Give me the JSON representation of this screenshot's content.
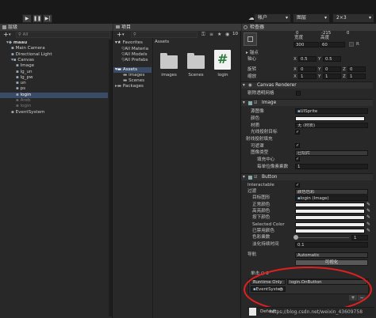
{
  "toolbar": {
    "account_label": "帐户",
    "layers_label": "图层",
    "layout_label": "2×3"
  },
  "hierarchy": {
    "tab": "层级",
    "search_placeholder": "All",
    "rows": [
      {
        "label": "maau",
        "state": "bold"
      },
      {
        "label": "Main Camera",
        "state": "normal"
      },
      {
        "label": "Directional Light",
        "state": "normal"
      },
      {
        "label": "Canvas",
        "state": "normal"
      },
      {
        "label": "Image",
        "state": "normal"
      },
      {
        "label": "lg_un",
        "state": "normal"
      },
      {
        "label": "lg_pw",
        "state": "normal"
      },
      {
        "label": "un",
        "state": "normal"
      },
      {
        "label": "ps",
        "state": "normal"
      },
      {
        "label": "login",
        "state": "selected"
      },
      {
        "label": "Areb",
        "state": "dim"
      },
      {
        "label": "login",
        "state": "dim"
      },
      {
        "label": "EventSystem",
        "state": "normal"
      }
    ]
  },
  "project": {
    "tab": "项目",
    "badge": "10",
    "favorites_label": "Favorites",
    "favorites": [
      "All Materia",
      "All Models",
      "All Prefabs"
    ],
    "assets_label": "Assets",
    "assets_children": [
      "images",
      "Scenes"
    ],
    "packages_label": "Packages",
    "breadcrumb": "Assets",
    "items": [
      {
        "name": "images",
        "kind": "folder"
      },
      {
        "name": "Scenes",
        "kind": "folder"
      },
      {
        "name": "login",
        "kind": "script",
        "glyph": "#"
      }
    ]
  },
  "inspector": {
    "tab": "检查器",
    "rect": {
      "values_top": [
        "0",
        "-215",
        "0"
      ],
      "labels_wh": [
        "宽度",
        "高度"
      ],
      "values_wh": [
        "300",
        "60"
      ],
      "anchor_label": "锚点",
      "pivot_label": "轴心",
      "pivot": [
        "X",
        "0.5",
        "Y",
        "0.5"
      ],
      "rotation_label": "旋转",
      "rotation": [
        "X",
        "0",
        "Y",
        "0",
        "Z",
        "0"
      ],
      "scale_label": "缩放",
      "scale": [
        "X",
        "1",
        "Y",
        "1",
        "Z",
        "1"
      ]
    },
    "canvas_renderer": {
      "title": "Canvas Renderer",
      "cull_label": "剔除透明网格"
    },
    "image": {
      "title": "Image",
      "rows": [
        {
          "label": "源图像",
          "value": "UISprite"
        },
        {
          "label": "颜色",
          "value": ""
        },
        {
          "label": "材质",
          "value": "无 (材质)"
        },
        {
          "label": "光线投射目标",
          "value": ""
        },
        {
          "label": "射线投射填充",
          "value": ""
        },
        {
          "label": "可遮罩",
          "value": ""
        },
        {
          "label": "图像类型",
          "value": "已切片"
        },
        {
          "label": "填充中心",
          "value": ""
        },
        {
          "label": "每单位像素乘数",
          "value": "1"
        }
      ]
    },
    "button": {
      "title": "Button",
      "interactable_label": "Interactable",
      "transition_label": "过渡",
      "transition_value": "颜色色彩",
      "target_label": "目标图形",
      "target_value": "login (Image)",
      "color_rows": [
        "正常颜色",
        "高亮颜色",
        "按下颜色",
        "Selected Color",
        "已禁用颜色"
      ],
      "multiplier_label": "色彩乘数",
      "multiplier_value": "1",
      "fade_label": "淡化持续时间",
      "fade_value": "0.1",
      "nav_label": "导航",
      "nav_value": "Automatic",
      "visualize_label": "可视化",
      "onclick_label": "单击 () 0",
      "runtime_value": "Runtime Only",
      "function_value": "login.OnButton",
      "object_value": "EventSysten"
    },
    "default_material": "Default",
    "watermark": "https://blog.csdn.net/weixin_43609758"
  },
  "colors": {
    "accent": "#3a4b67",
    "panel": "#282828",
    "highlight_circle": "#e02020"
  }
}
